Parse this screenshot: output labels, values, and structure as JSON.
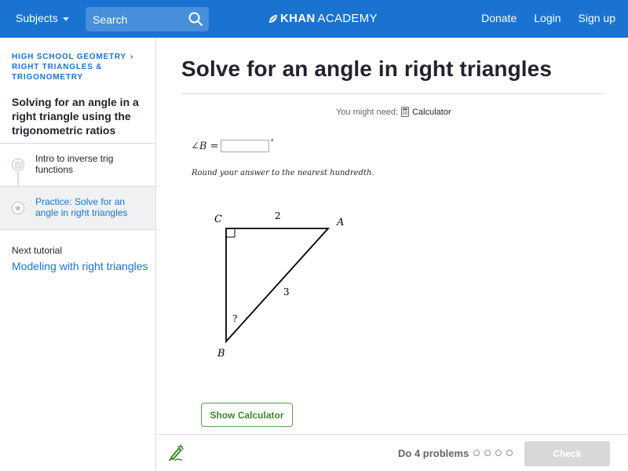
{
  "nav": {
    "subjects": "Subjects",
    "search_placeholder": "Search",
    "logo_bold": "KHAN",
    "logo_regular": "ACADEMY",
    "donate": "Donate",
    "login": "Login",
    "signup": "Sign up"
  },
  "sidebar": {
    "breadcrumbs": [
      "HIGH SCHOOL GEOMETRY",
      "RIGHT TRIANGLES & TRIGONOMETRY"
    ],
    "tutorial_title": "Solving for an angle in a right triangle using the trigonometric ratios",
    "items": [
      {
        "label": "Intro to inverse trig functions",
        "icon": "video-icon",
        "active": false
      },
      {
        "label": "Practice: Solve for an angle in right triangles",
        "icon": "star-icon",
        "active": true
      }
    ],
    "next_label": "Next tutorial",
    "next_link": "Modeling with right triangles"
  },
  "main": {
    "title": "Solve for an angle in right triangles",
    "might_need": "You might need:",
    "calculator_link": "Calculator",
    "answer_prefix": "∠B =",
    "degree": "°",
    "hint": "Round your answer to the nearest hundredth.",
    "triangle": {
      "vertex_c": "C",
      "vertex_a": "A",
      "vertex_b": "B",
      "side_ca": "2",
      "side_ab": "3",
      "angle_b": "?"
    },
    "show_calculator": "Show Calculator"
  },
  "footer": {
    "do_label": "Do 4 problems",
    "problem_count": 4,
    "check": "Check"
  },
  "colors": {
    "nav_blue": "#1a73d1",
    "link_blue": "#1a73d1",
    "green": "#3a8a2a",
    "check_disabled": "#d6d8da"
  }
}
